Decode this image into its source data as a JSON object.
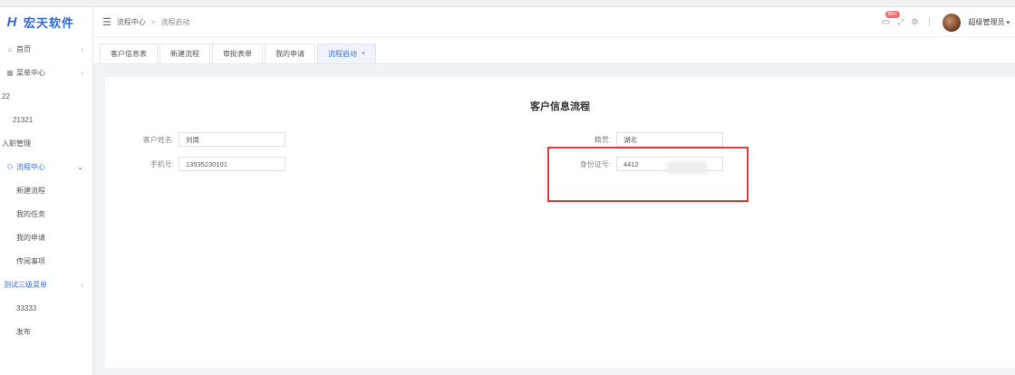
{
  "app": {
    "logo_text": "宏天软件",
    "logo_mark": "H"
  },
  "sidebar": {
    "items": [
      {
        "label": "首页",
        "icon": "home-icon",
        "arrow": "›"
      },
      {
        "label": "菜单中心",
        "icon": "grid-icon",
        "arrow": "›"
      },
      {
        "label": "22"
      },
      {
        "label": "21321"
      },
      {
        "label": "入职管理"
      },
      {
        "label": "流程中心",
        "icon": "user-icon",
        "arrow": "⌄",
        "active": true
      },
      {
        "label": "新建流程"
      },
      {
        "label": "我的任务"
      },
      {
        "label": "我的申请"
      },
      {
        "label": "传阅事项"
      },
      {
        "label": "测试三级菜单",
        "arrow": "›"
      },
      {
        "label": "33333"
      },
      {
        "label": "发布"
      }
    ]
  },
  "header": {
    "breadcrumb": [
      "流程中心",
      "流程启动"
    ],
    "breadcrumb_sep": ">",
    "message_badge": "99+",
    "username": "超级管理员",
    "caret": "▾"
  },
  "tabs": [
    {
      "label": "客户信息表"
    },
    {
      "label": "新建流程"
    },
    {
      "label": "审批表单"
    },
    {
      "label": "我的申请"
    },
    {
      "label": "流程启动",
      "active": true,
      "close": "×"
    }
  ],
  "form": {
    "title": "客户信息流程",
    "fields": {
      "customer_name": {
        "label": "客户姓名:",
        "value": "刘周"
      },
      "phone": {
        "label": "手机号:",
        "value": "13535230101"
      },
      "native_place": {
        "label": "籍贯:",
        "value": "湖北"
      },
      "id_number": {
        "label": "身份证号:",
        "value": "4412"
      }
    }
  },
  "colors": {
    "accent": "#3b6fd8",
    "highlight_border": "#e0393e",
    "badge": "#f56c6c"
  }
}
